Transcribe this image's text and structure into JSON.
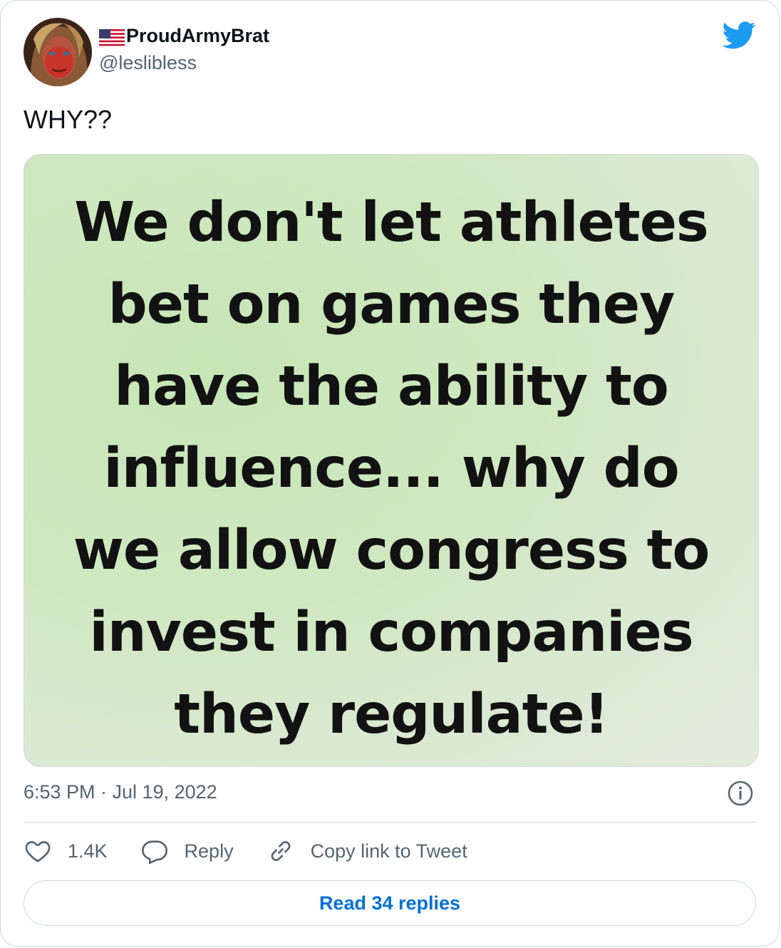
{
  "tweet": {
    "display_name": "ProudArmyBrat",
    "handle": "@leslibless",
    "text": "WHY??",
    "image_text_lines": [
      "We don't let athletes",
      "bet on games they",
      "have the ability to",
      "influence... why do",
      "we allow congress to",
      "invest in companies",
      "they regulate!"
    ],
    "timestamp": "6:53 PM · Jul 19, 2022"
  },
  "actions": {
    "likes": "1.4K",
    "reply_label": "Reply",
    "copy_label": "Copy link to Tweet"
  },
  "read_replies_label": "Read 34 replies",
  "icons": {
    "flag": "us-flag-icon",
    "brand": "twitter-bird-icon",
    "info": "info-icon",
    "like": "heart-icon",
    "reply": "speech-bubble-icon",
    "copy": "link-icon"
  },
  "colors": {
    "brand": "#1d9bf0",
    "link": "#006fd6",
    "secondary_text": "#536471"
  }
}
